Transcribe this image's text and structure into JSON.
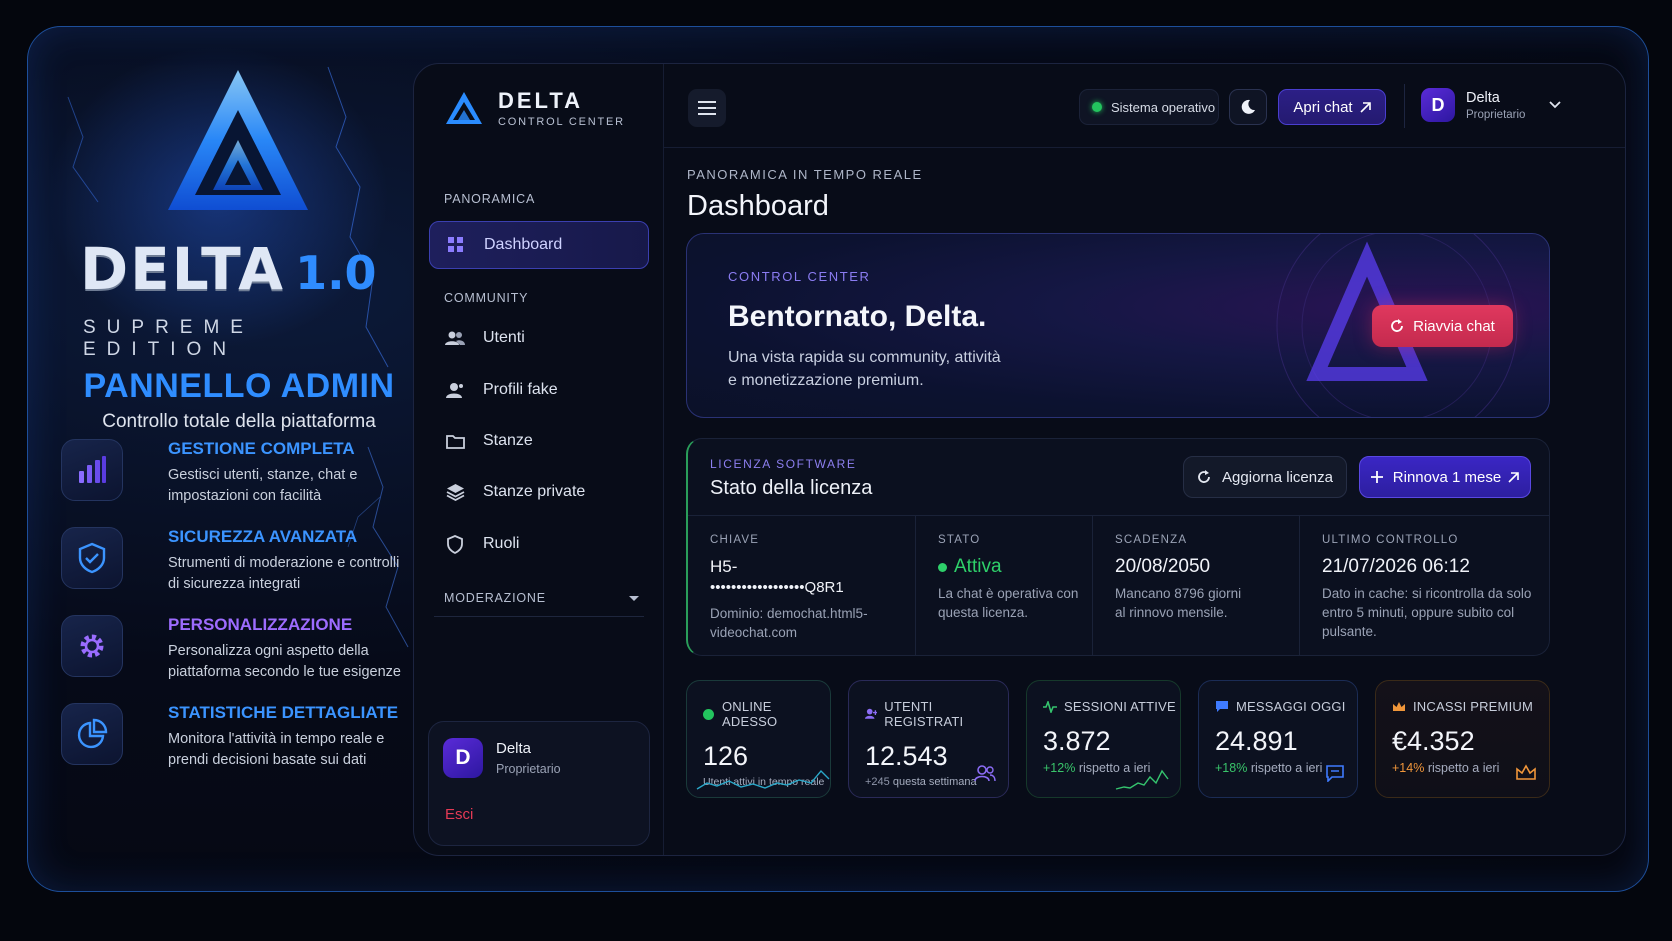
{
  "promo": {
    "brand_word": "DELTA",
    "brand_version": "1.0",
    "edition": "SUPREME EDITION",
    "title": "PANNELLO ADMIN",
    "subtitle": "Controllo totale della piattaforma",
    "features": [
      {
        "icon": "bar-chart-icon",
        "title": "GESTIONE COMPLETA",
        "desc": "Gestisci utenti, stanze, chat e impostazioni con facilità"
      },
      {
        "icon": "shield-check-icon",
        "title": "SICUREZZA AVANZATA",
        "desc": "Strumenti di moderazione e controlli di sicurezza integrati"
      },
      {
        "icon": "gear-icon",
        "title": "PERSONALIZZAZIONE",
        "desc": "Personalizza ogni aspetto della piattaforma secondo le tue esigenze"
      },
      {
        "icon": "pie-chart-icon",
        "title": "STATISTICHE DETTAGLIATE",
        "desc": "Monitora l'attività in tempo reale e prendi decisioni basate sui dati"
      }
    ]
  },
  "sidebar": {
    "logo_title": "DELTA",
    "logo_sub": "CONTROL CENTER",
    "section_overview": "PANORAMICA",
    "section_community": "COMMUNITY",
    "section_moderation": "MODERAZIONE",
    "items": {
      "dashboard": "Dashboard",
      "users": "Utenti",
      "fake_profiles": "Profili fake",
      "rooms": "Stanze",
      "private_rooms": "Stanze private",
      "roles": "Ruoli"
    },
    "user": {
      "initial": "D",
      "name": "Delta",
      "role": "Proprietario",
      "logout": "Esci"
    }
  },
  "topbar": {
    "status": "Sistema operativo",
    "chat_button": "Apri chat",
    "user": {
      "initial": "D",
      "name": "Delta",
      "role": "Proprietario"
    }
  },
  "main": {
    "eyebrow": "PANORAMICA IN TEMPO REALE",
    "title": "Dashboard",
    "hero": {
      "label": "CONTROL CENTER",
      "welcome": "Bentornato, Delta.",
      "desc_line1": "Una vista rapida su community, attività",
      "desc_line2": "e monetizzazione premium.",
      "restart_button": "Riavvia chat"
    },
    "license": {
      "label": "LICENZA SOFTWARE",
      "title": "Stato della licenza",
      "update_button": "Aggiorna licenza",
      "renew_button": "Rinnova 1 mese",
      "key_label": "CHIAVE",
      "key_line1": "H5-",
      "key_line2": "••••••••••••••••••Q8R1",
      "key_domain": "Dominio: demochat.html5-videochat.com",
      "status_label": "STATO",
      "status_value": "Attiva",
      "status_desc": "La chat è operativa con questa licenza.",
      "expiry_label": "SCADENZA",
      "expiry_value": "20/08/2050",
      "expiry_desc": "Mancano 8796 giorni al rinnovo mensile.",
      "check_label": "ULTIMO CONTROLLO",
      "check_value": "21/07/2026 06:12",
      "check_desc": "Dato in cache: si ricontrolla da solo entro 5 minuti, oppure subito col pulsante."
    },
    "stats": [
      {
        "label": "ONLINE ADESSO",
        "value": "126",
        "sub": "Utenti attivi in tempo reale",
        "trend": "",
        "color": "#23c45e"
      },
      {
        "label": "UTENTI REGISTRATI",
        "value": "12.543",
        "sub": "questa settimana",
        "trend": "+245",
        "color": "#8b6cf5"
      },
      {
        "label": "SESSIONI ATTIVE",
        "value": "3.872",
        "sub": "rispetto a ieri",
        "trend": "+12%",
        "color": "#35c46e"
      },
      {
        "label": "MESSAGGI OGGI",
        "value": "24.891",
        "sub": "rispetto a ieri",
        "trend": "+18%",
        "color": "#3f7bff"
      },
      {
        "label": "INCASSI PREMIUM",
        "value": "€4.352",
        "sub": "rispetto a ieri",
        "trend": "+14%",
        "color": "#f0963a"
      }
    ]
  }
}
